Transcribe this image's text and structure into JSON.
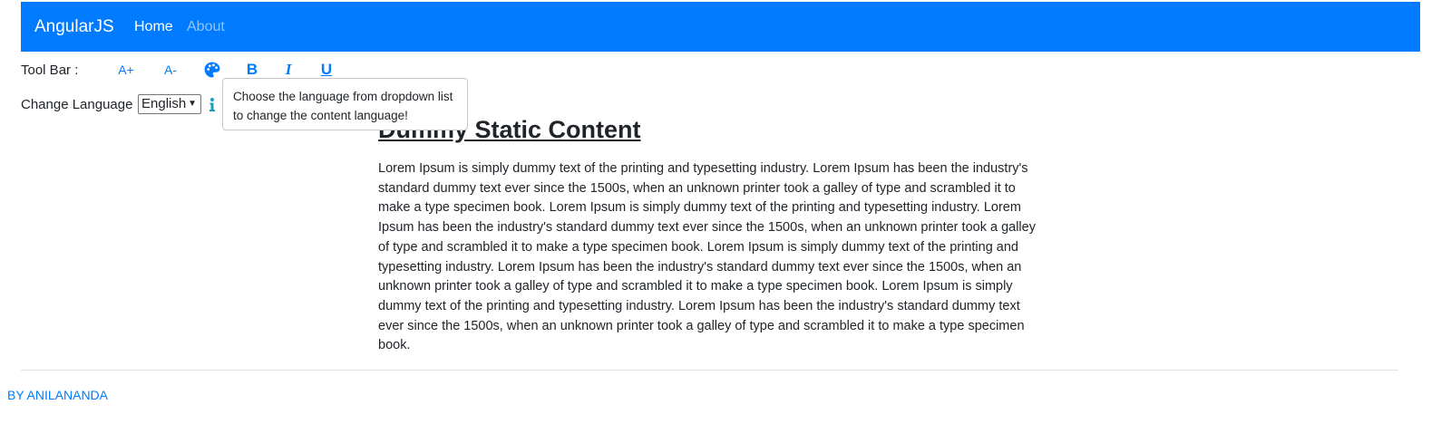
{
  "navbar": {
    "brand": "AngularJS",
    "links": [
      {
        "label": "Home",
        "active": true
      },
      {
        "label": "About",
        "active": false
      }
    ],
    "background_color": "#007bff"
  },
  "toolbar": {
    "label": "Tool Bar :",
    "buttons": [
      {
        "label": "A+",
        "action": "increase-font"
      },
      {
        "label": "A-",
        "action": "decrease-font"
      },
      {
        "icon": "palette-icon",
        "action": "change-color"
      },
      {
        "label": "B",
        "action": "bold"
      },
      {
        "label": "I",
        "action": "italic"
      },
      {
        "label": "U",
        "action": "underline"
      }
    ],
    "accent_color": "#007bff"
  },
  "language": {
    "label": "Change Language :",
    "selected": "English",
    "info_icon": "info-icon",
    "tooltip": "Choose the language from dropdown list to change the content language!"
  },
  "content": {
    "title": "Dummy Static Content",
    "body": "Lorem Ipsum is simply dummy text of the printing and typesetting industry. Lorem Ipsum has been the industry's standard dummy text ever since the 1500s, when an unknown printer took a galley of type and scrambled it to make a type specimen book. Lorem Ipsum is simply dummy text of the printing and typesetting industry. Lorem Ipsum has been the industry's standard dummy text ever since the 1500s, when an unknown printer took a galley of type and scrambled it to make a type specimen book. Lorem Ipsum is simply dummy text of the printing and typesetting industry. Lorem Ipsum has been the industry's standard dummy text ever since the 1500s, when an unknown printer took a galley of type and scrambled it to make a type specimen book. Lorem Ipsum is simply dummy text of the printing and typesetting industry. Lorem Ipsum has been the industry's standard dummy text ever since the 1500s, when an unknown printer took a galley of type and scrambled it to make a type specimen book."
  },
  "footer": {
    "credit": "BY ANILANANDA"
  }
}
